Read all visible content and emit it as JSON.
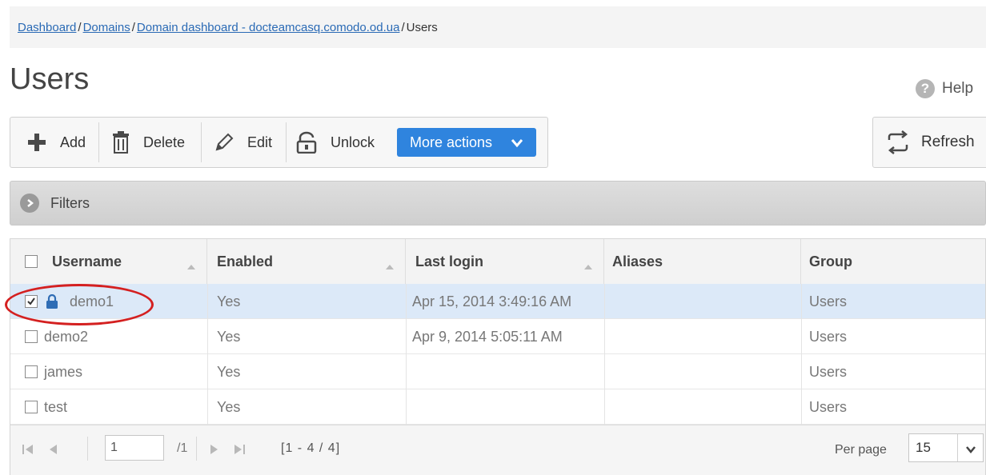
{
  "breadcrumb": {
    "items": [
      "Dashboard",
      "Domains",
      "Domain dashboard - docteamcasq.comodo.od.ua"
    ],
    "current": "Users",
    "separator": "/"
  },
  "page": {
    "title": "Users"
  },
  "help": {
    "label": "Help",
    "glyph": "?"
  },
  "toolbar": {
    "add_label": "Add",
    "delete_label": "Delete",
    "edit_label": "Edit",
    "unlock_label": "Unlock",
    "more_actions_label": "More actions"
  },
  "refresh": {
    "label": "Refresh"
  },
  "filters": {
    "label": "Filters"
  },
  "table": {
    "columns": [
      "Username",
      "Enabled",
      "Last login",
      "Aliases",
      "Group"
    ],
    "rows": [
      {
        "username": "demo1",
        "enabled": "Yes",
        "last_login": "Apr 15, 2014 3:49:16 AM",
        "aliases": "",
        "group": "Users",
        "checked": true,
        "locked": true
      },
      {
        "username": "demo2",
        "enabled": "Yes",
        "last_login": "Apr 9, 2014 5:05:11 AM",
        "aliases": "",
        "group": "Users",
        "checked": false,
        "locked": false
      },
      {
        "username": "james",
        "enabled": "Yes",
        "last_login": "",
        "aliases": "",
        "group": "Users",
        "checked": false,
        "locked": false
      },
      {
        "username": "test",
        "enabled": "Yes",
        "last_login": "",
        "aliases": "",
        "group": "Users",
        "checked": false,
        "locked": false
      }
    ]
  },
  "pager": {
    "page": "1",
    "total_pages": "/1",
    "range": "[1 - 4 / 4]",
    "per_page_label": "Per page",
    "per_page_value": "15"
  },
  "colors": {
    "accent": "#2f84de",
    "link": "#2a6ab5",
    "selected_row": "#dce9f8",
    "highlight_circle": "#d42020"
  }
}
